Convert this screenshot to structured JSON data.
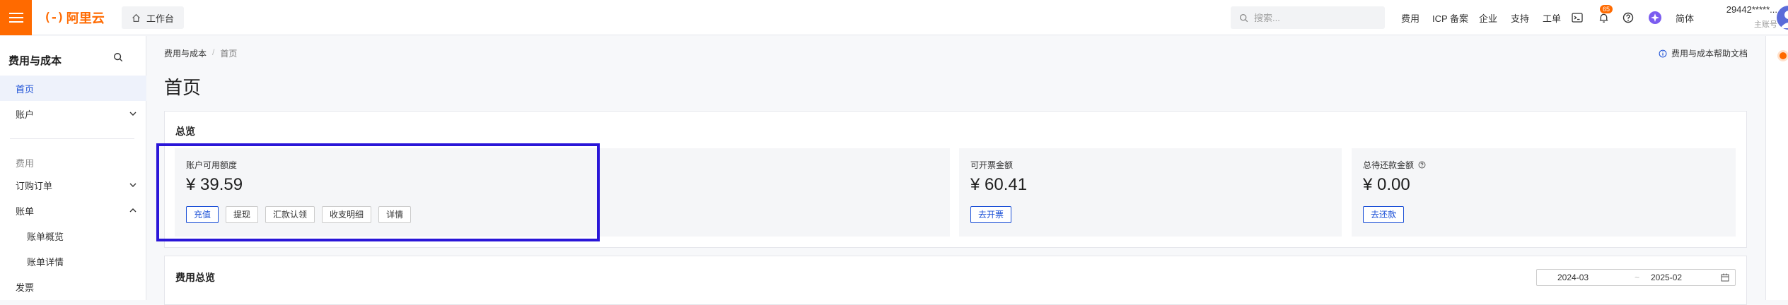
{
  "topbar": {
    "logo_text": "阿里云",
    "logo_mark": "(-)",
    "workbench_label": "工作台",
    "search_placeholder": "搜索...",
    "nav": [
      "费用",
      "ICP 备案",
      "企业",
      "支持",
      "工单"
    ],
    "notification_count": "65",
    "language": "简体",
    "account_name": "29442*****...",
    "account_role": "主账号",
    "brand_color": "#ff6a00"
  },
  "sidebar": {
    "title": "费用与成本",
    "items": {
      "home": "首页",
      "account": "账户",
      "group_fee": "费用",
      "orders": "订购订单",
      "bill": "账单",
      "bill_overview": "账单概览",
      "bill_detail": "账单详情",
      "invoice": "发票"
    },
    "active_color": "#1a4fd6"
  },
  "breadcrumb": {
    "root": "费用与成本",
    "sep": "/",
    "current": "首页"
  },
  "help_link": "费用与成本帮助文档",
  "page_title": "首页",
  "overview": {
    "title": "总览",
    "available": {
      "label": "账户可用额度",
      "amount": "¥ 39.59",
      "buttons": [
        "充值",
        "提现",
        "汇款认领",
        "收支明细",
        "详情"
      ]
    },
    "invoiceable": {
      "label": "可开票金额",
      "amount": "¥ 60.41",
      "button": "去开票"
    },
    "repay": {
      "label": "总待还款金额",
      "amount": "¥ 0.00",
      "button": "去还款"
    },
    "highlight_color": "#2a16d8"
  },
  "cost_overview": {
    "title": "费用总览",
    "start": "2024-03",
    "tilde": "~",
    "end": "2025-02"
  }
}
